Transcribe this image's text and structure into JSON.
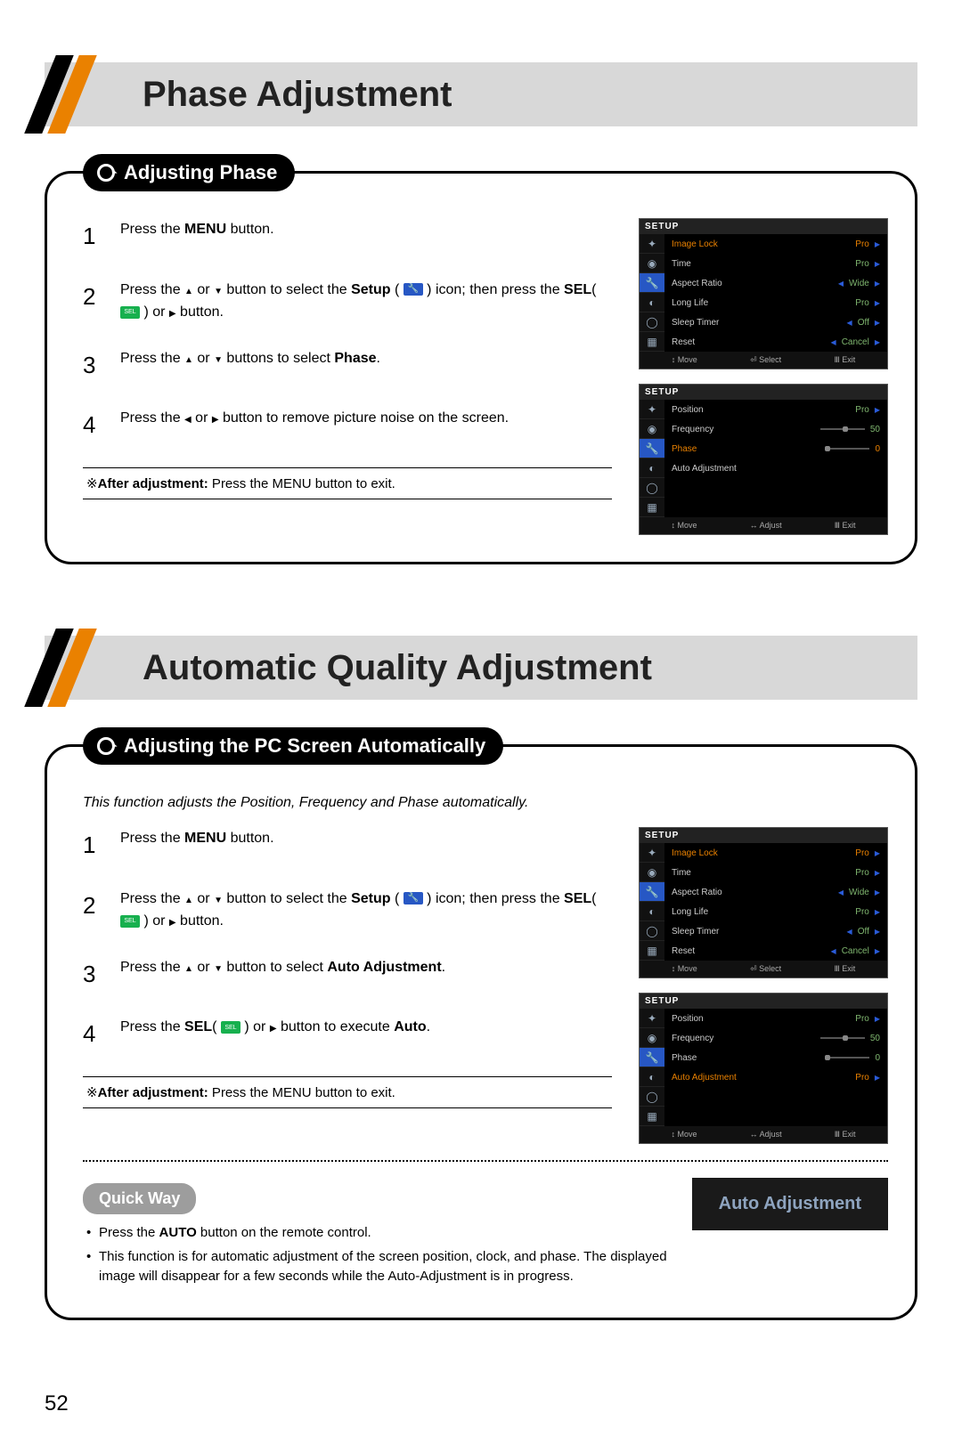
{
  "page_number": "52",
  "section1": {
    "header": "Phase Adjustment",
    "pill": "Adjusting Phase",
    "step1_a": "Press the ",
    "step1_b": "MENU",
    "step1_c": " button.",
    "step2_a": "Press the ",
    "step2_b": " or ",
    "step2_c": " button to select the ",
    "step2_d": "Setup",
    "step2_e": " ( ",
    "step2_f": " ) icon; then press the ",
    "step2_g": "SEL",
    "step2_h": "( ",
    "step2_i": " ) or ",
    "step2_j": " button.",
    "step3_a": "Press the ",
    "step3_b": " or ",
    "step3_c": " buttons to select ",
    "step3_d": "Phase",
    "step3_e": ".",
    "step4_a": "Press the ",
    "step4_b": " or ",
    "step4_c": " button to remove picture noise on the screen.",
    "note_a": "※",
    "note_b": "After adjustment:",
    "note_c": " Press the MENU button to exit."
  },
  "section2": {
    "header": "Automatic Quality Adjustment",
    "pill": "Adjusting the PC Screen Automatically",
    "intro": "This function adjusts the Position, Frequency and Phase automatically.",
    "step1_a": "Press the ",
    "step1_b": "MENU",
    "step1_c": " button.",
    "step2_a": "Press the ",
    "step2_b": " or ",
    "step2_c": " button to select the ",
    "step2_d": "Setup",
    "step2_e": " ( ",
    "step2_f": " ) icon; then press the ",
    "step2_g": "SEL",
    "step2_h": "( ",
    "step2_i": " ) or ",
    "step2_j": " button.",
    "step3_a": "Press the ",
    "step3_b": " or ",
    "step3_c": " button to select ",
    "step3_d": "Auto Adjustment",
    "step3_e": ".",
    "step4_a": "Press the ",
    "step4_b": "SEL",
    "step4_c": "( ",
    "step4_d": " ) or ",
    "step4_e": " button to execute ",
    "step4_f": "Auto",
    "step4_g": ".",
    "note_a": "※",
    "note_b": "After adjustment:",
    "note_c": " Press the MENU button to exit.",
    "quick_title": "Quick Way",
    "quick1_a": "Press the ",
    "quick1_b": "AUTO",
    "quick1_c": " button on the remote control.",
    "quick2": "This function is for automatic adjustment of the screen position, clock, and phase. The displayed image will disappear for a few seconds while the Auto-Adjustment is in progress.",
    "auto_badge": "Auto Adjustment"
  },
  "osd": {
    "setup_title": "SETUP",
    "menu1": {
      "r1_l": "Image Lock",
      "r1_v": "Pro",
      "r2_l": "Time",
      "r2_v": "Pro",
      "r3_l": "Aspect Ratio",
      "r3_v": "Wide",
      "r4_l": "Long Life",
      "r4_v": "Pro",
      "r5_l": "Sleep Timer",
      "r5_v": "Off",
      "r6_l": "Reset",
      "r6_v": "Cancel",
      "f1": "↕ Move",
      "f2": "⏎ Select",
      "f3": "Ⅲ Exit"
    },
    "menu2_phase": {
      "r1_l": "Position",
      "r1_v": "Pro",
      "r2_l": "Frequency",
      "r2_v": "50",
      "r3_l": "Phase",
      "r3_v": "0",
      "r4_l": "Auto Adjustment",
      "f1": "↕ Move",
      "f2": "↔ Adjust",
      "f3": "Ⅲ Exit"
    },
    "menu2_auto": {
      "r1_l": "Position",
      "r1_v": "Pro",
      "r2_l": "Frequency",
      "r2_v": "50",
      "r3_l": "Phase",
      "r3_v": "0",
      "r4_l": "Auto Adjustment",
      "r4_v": "Pro",
      "f1": "↕ Move",
      "f2": "↔ Adjust",
      "f3": "Ⅲ Exit"
    }
  }
}
